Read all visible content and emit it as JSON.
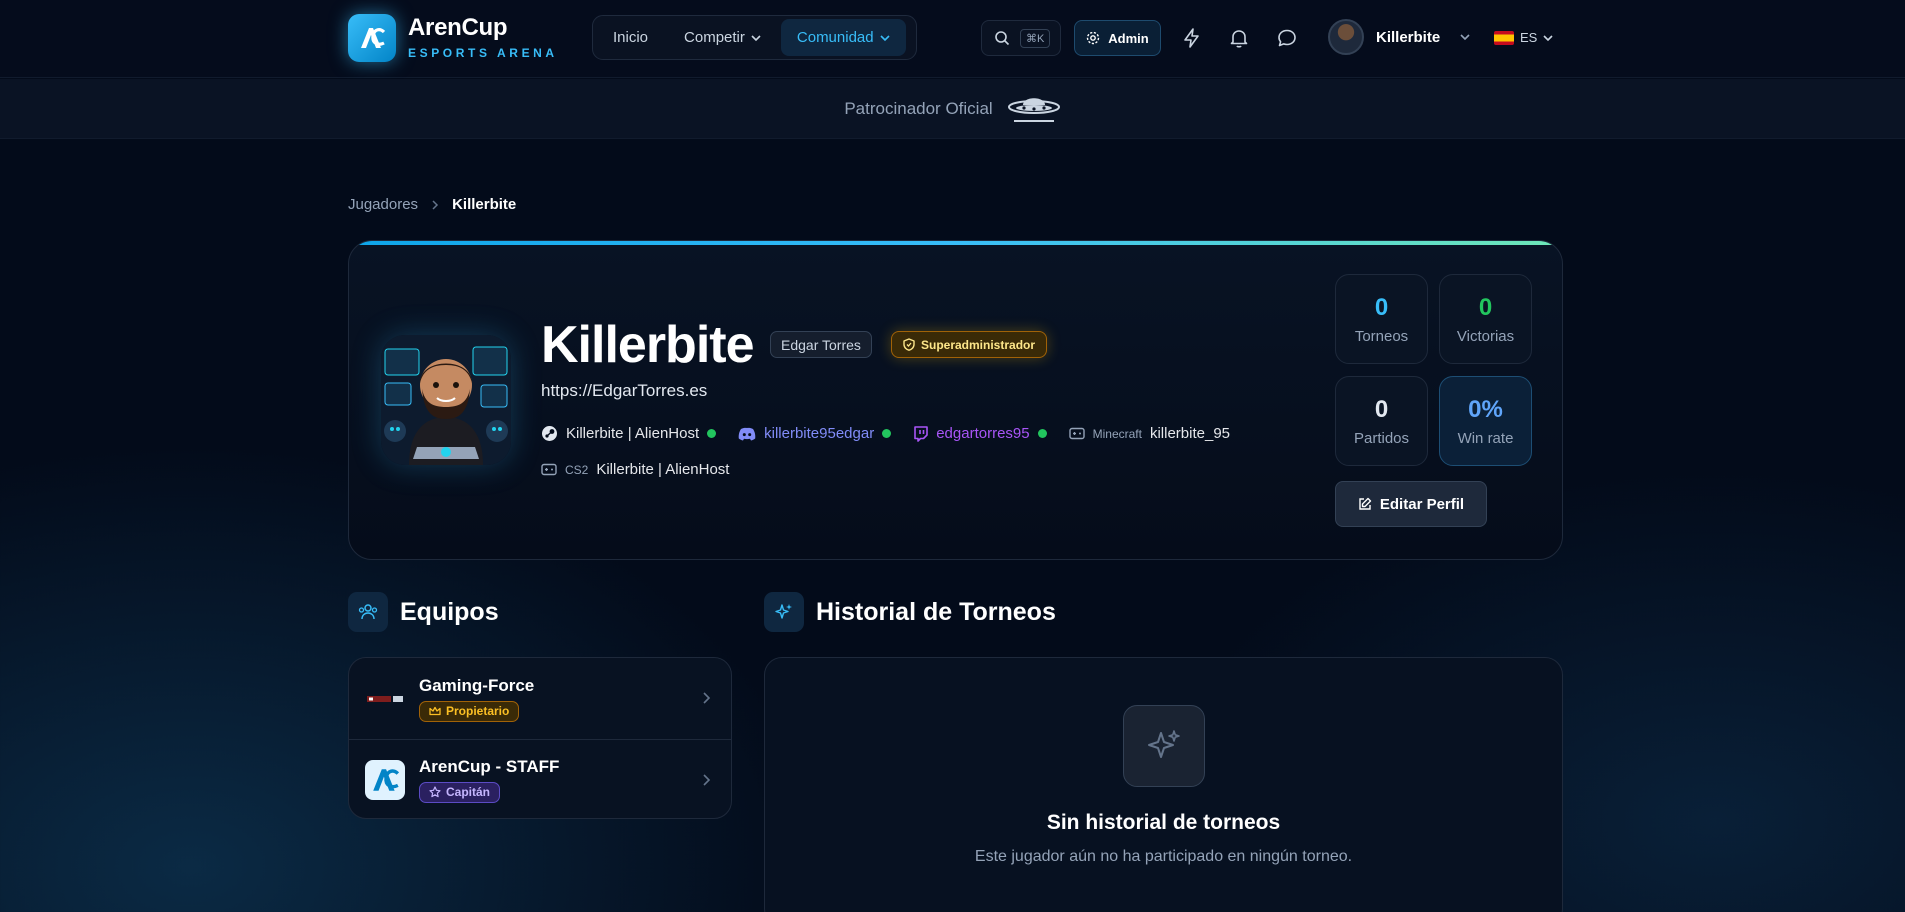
{
  "brand": {
    "name": "ArenCup",
    "tagline": "ESPORTS ARENA"
  },
  "nav": {
    "items": [
      {
        "label": "Inicio"
      },
      {
        "label": "Competir"
      },
      {
        "label": "Comunidad"
      }
    ]
  },
  "search": {
    "shortcut": "⌘K"
  },
  "admin": {
    "label": "Admin"
  },
  "user": {
    "name": "Killerbite"
  },
  "lang": {
    "code": "ES"
  },
  "sponsor": {
    "label": "Patrocinador Oficial"
  },
  "breadcrumb": {
    "parent": "Jugadores",
    "current": "Killerbite"
  },
  "profile": {
    "name": "Killerbite",
    "real_name": "Edgar Torres",
    "role": "Superadministrador",
    "website": "https://EdgarTorres.es",
    "steam": "Killerbite | AlienHost",
    "discord": "killerbite95edgar",
    "twitch": "edgartorres95",
    "minecraft_label": "Minecraft",
    "minecraft": "killerbite_95",
    "cs2_label": "CS2",
    "cs2": "Killerbite | AlienHost"
  },
  "stats": {
    "torneos": {
      "value": "0",
      "label": "Torneos"
    },
    "victorias": {
      "value": "0",
      "label": "Victorias"
    },
    "partidos": {
      "value": "0",
      "label": "Partidos"
    },
    "winrate": {
      "value": "0%",
      "label": "Win rate"
    }
  },
  "edit_button": "Editar Perfil",
  "teams": {
    "title": "Equipos",
    "items": [
      {
        "name": "Gaming-Force",
        "role": "Propietario"
      },
      {
        "name": "ArenCup - STAFF",
        "role": "Capitán"
      }
    ]
  },
  "history": {
    "title": "Historial de Torneos",
    "empty_title": "Sin historial de torneos",
    "empty_sub": "Este jugador aún no ha participado en ningún torneo."
  },
  "colors": {
    "accent": "#38bdf8",
    "green": "#22c55e",
    "discord": "#818cf8",
    "twitch": "#a855f7",
    "gold": "#fbbf24"
  }
}
